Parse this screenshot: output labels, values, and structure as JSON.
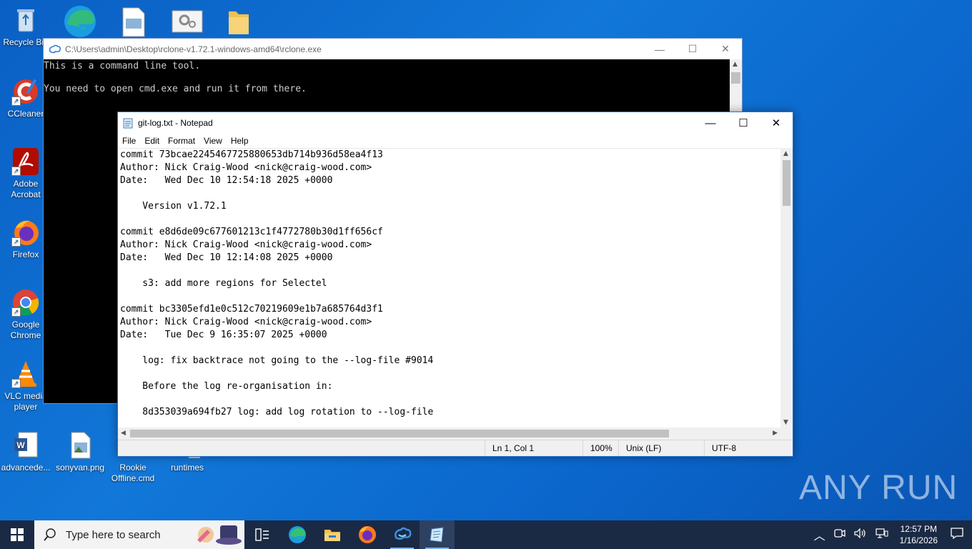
{
  "desktop_icons": [
    {
      "label": "Recycle Bin",
      "icon": "recycle-bin-icon"
    },
    {
      "label": "CCleaner",
      "icon": "ccleaner-icon"
    },
    {
      "label": "Adobe Acrobat",
      "icon": "acrobat-icon"
    },
    {
      "label": "Firefox",
      "icon": "firefox-icon"
    },
    {
      "label": "Google Chrome",
      "icon": "chrome-icon"
    },
    {
      "label": "VLC media player",
      "icon": "vlc-icon"
    },
    {
      "label": "advancede...",
      "icon": "word-document-icon"
    },
    {
      "label": "sonyvan.png",
      "icon": "image-file-icon"
    },
    {
      "label": "Rookie Offline.cmd",
      "icon": "cmd-file-icon"
    },
    {
      "label": "runtimes",
      "icon": "folder-icon"
    }
  ],
  "cmd": {
    "title": "C:\\Users\\admin\\Desktop\\rclone-v1.72.1-windows-amd64\\rclone.exe",
    "lines": [
      "This is a command line tool.",
      "",
      "You need to open cmd.exe and run it from there."
    ]
  },
  "notepad": {
    "title": "git-log.txt - Notepad",
    "menu": [
      "File",
      "Edit",
      "Format",
      "View",
      "Help"
    ],
    "content": "commit 73bcae2245467725880653db714b936d58ea4f13\nAuthor: Nick Craig-Wood <nick@craig-wood.com>\nDate:   Wed Dec 10 12:54:18 2025 +0000\n\n    Version v1.72.1\n\ncommit e8d6de09c677601213c1f4772780b30d1ff656cf\nAuthor: Nick Craig-Wood <nick@craig-wood.com>\nDate:   Wed Dec 10 12:14:08 2025 +0000\n\n    s3: add more regions for Selectel\n\ncommit bc3305efd1e0c512c70219609e1b7a685764d3f1\nAuthor: Nick Craig-Wood <nick@craig-wood.com>\nDate:   Tue Dec 9 16:35:07 2025 +0000\n\n    log: fix backtrace not going to the --log-file #9014\n\n    Before the log re-organisation in:\n\n    8d353039a694fb27 log: add log rotation to --log-file",
    "status": {
      "position": "Ln 1, Col 1",
      "zoom": "100%",
      "line_ending": "Unix (LF)",
      "encoding": "UTF-8"
    }
  },
  "taskbar": {
    "search_placeholder": "Type here to search",
    "apps": [
      "task-view-icon",
      "edge-icon",
      "file-explorer-icon",
      "firefox-icon",
      "rclone-icon",
      "notepad-icon"
    ],
    "time": "12:57 PM",
    "date": "1/16/2026"
  },
  "watermark": "ANY RUN"
}
